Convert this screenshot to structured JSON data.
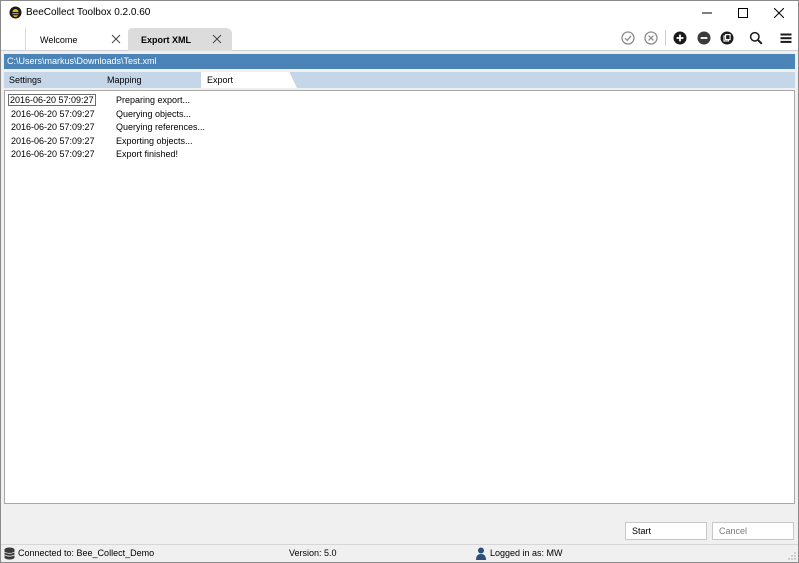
{
  "window": {
    "title": "BeeCollect Toolbox 0.2.0.60"
  },
  "tabs": [
    {
      "label": "Welcome"
    },
    {
      "label": "Export XML"
    }
  ],
  "toolbar": {
    "icons": [
      "check-circle-icon",
      "cancel-circle-icon",
      "add-circle-icon",
      "remove-circle-icon",
      "copy-circle-icon",
      "search-icon",
      "menu-icon"
    ]
  },
  "path": "C:\\Users\\markus\\Downloads\\Test.xml",
  "subtabs": [
    {
      "label": "Settings"
    },
    {
      "label": "Mapping"
    },
    {
      "label": "Export"
    }
  ],
  "log": [
    {
      "time": "2016-06-20 57:09:27",
      "message": "Preparing export..."
    },
    {
      "time": "2016-06-20 57:09:27",
      "message": "Querying objects..."
    },
    {
      "time": "2016-06-20 57:09:27",
      "message": "Querying references..."
    },
    {
      "time": "2016-06-20 57:09:27",
      "message": "Exporting objects..."
    },
    {
      "time": "2016-06-20 57:09:27",
      "message": "Export finished!"
    }
  ],
  "buttons": {
    "start": "Start",
    "cancel": "Cancel"
  },
  "status": {
    "connection": "Connected to: Bee_Collect_Demo",
    "version": "Version: 5.0",
    "user": "Logged in as: MW"
  },
  "colors": {
    "accent": "#4c84b8",
    "subtab_bar": "#c5d6e8"
  }
}
